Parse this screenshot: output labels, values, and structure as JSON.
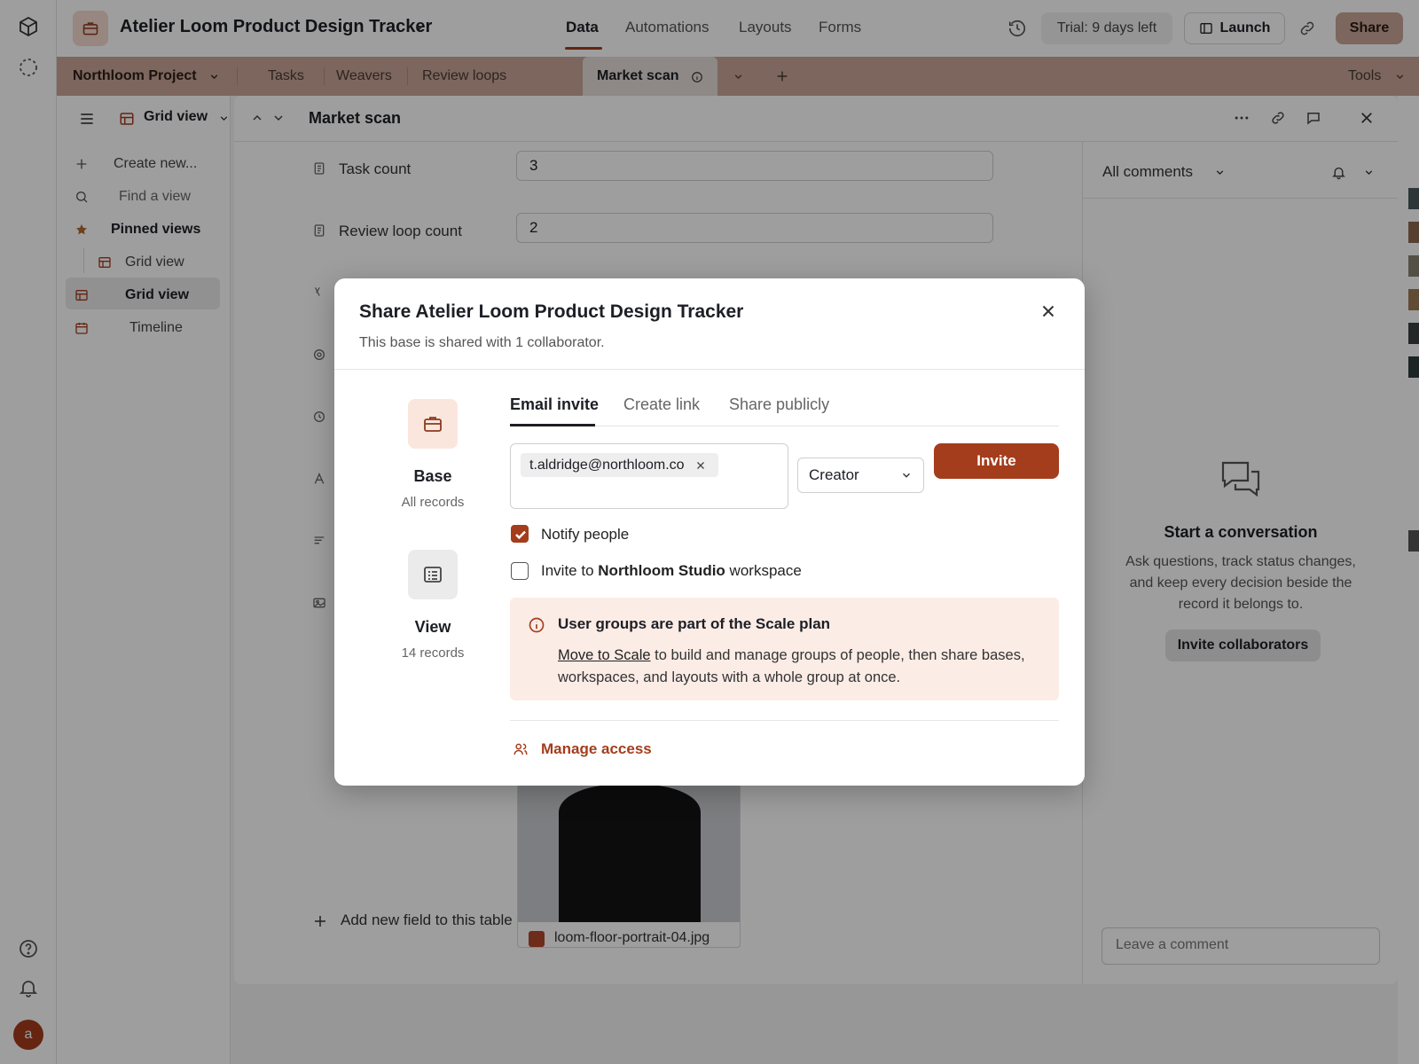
{
  "app": {
    "base_name": "Atelier Loom Product Design Tracker",
    "nav_tabs": [
      "Data",
      "Automations",
      "Layouts",
      "Forms"
    ],
    "trial": "Trial: 9 days left",
    "launch": "Launch",
    "share": "Share",
    "avatar_initial": "a"
  },
  "tables": {
    "project": "Northloom Project",
    "items": [
      "Tasks",
      "Weavers",
      "Review loops"
    ],
    "active": "Market scan",
    "tools": "Tools"
  },
  "sidebar": {
    "view_selector": "Grid view",
    "create_new": "Create new...",
    "find_view": "Find a view",
    "pinned_header": "Pinned views",
    "pinned_item": "Grid view",
    "active_view": "Grid view",
    "timeline": "Timeline"
  },
  "record": {
    "title": "Market scan",
    "fields": [
      {
        "label": "Task count",
        "value": "3"
      },
      {
        "label": "Review loop count",
        "value": "2"
      }
    ],
    "attachment_name": "loom-floor-portrait-04.jpg",
    "add_field": "Add new field to this table"
  },
  "comments": {
    "filter": "All comments",
    "empty_title": "Start a conversation",
    "empty_body": "Ask questions, track status changes, and keep every decision beside the record it belongs to.",
    "invite_button": "Invite collaborators",
    "input_placeholder": "Leave a comment"
  },
  "modal": {
    "title": "Share Atelier Loom Product Design Tracker",
    "subtitle": "This base is shared with 1 collaborator.",
    "scopes": [
      {
        "name": "Base",
        "sub": "All records"
      },
      {
        "name": "View",
        "sub": "14 records"
      }
    ],
    "tabs": [
      "Email invite",
      "Create link",
      "Share publicly"
    ],
    "email_chip": "t.aldridge@northloom.co",
    "role": "Creator",
    "invite": "Invite",
    "notify_label": "Notify people",
    "notify_checked": true,
    "workspace_prefix": "Invite to",
    "workspace_name": "Northloom Studio",
    "workspace_suffix": "workspace",
    "workspace_checked": false,
    "notice_title": "User groups are part of the Scale plan",
    "notice_link": "Move to Scale",
    "notice_body": " to build and manage groups of people, then share bases, workspaces, and layouts with a whole group at once.",
    "manage_access": "Manage access"
  },
  "colors": {
    "accent": "#a43d1c",
    "tabbar": "#c8a596",
    "notice_bg": "#fbece6"
  }
}
